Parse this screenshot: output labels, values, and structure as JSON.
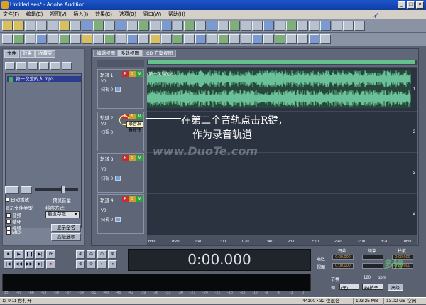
{
  "window": {
    "title": "Untitled.ses* - Adobe Audition",
    "btn_min": "_",
    "btn_max": "□",
    "btn_close": "×"
  },
  "menu": [
    "文件(F)",
    "编辑(E)",
    "视图(V)",
    "插入(I)",
    "效果(C)",
    "选项(O)",
    "窗口(W)",
    "帮助(H)"
  ],
  "left_panel": {
    "tabs": [
      "文件",
      "效果",
      "收藏夹"
    ],
    "file_item": "第一次爱的人.mp3",
    "auto_play": "自动播放",
    "preview_label": "预览音量",
    "show_type_label": "显示文件类型",
    "sort_label": "排序方式:",
    "sort_value": "最近存取",
    "types": [
      "音频",
      "循环",
      "视频",
      "MIDI"
    ],
    "full_name_btn": "显示全名",
    "advanced_btn": "高级选项"
  },
  "main": {
    "tabs": [
      "编辑视图",
      "多轨视图",
      "CD 方案视图"
    ],
    "tracks": [
      {
        "name": "轨道 1",
        "m": "M",
        "r": "R",
        "s": "S",
        "v_label": "V0",
        "out_label": "扫视 0",
        "in_label": "R",
        "number": "1"
      },
      {
        "name": "轨道 2",
        "m": "M",
        "r": "R",
        "s": "S",
        "v_label": "V0",
        "out_label": "扫视 0",
        "in_label": "R",
        "number": "2"
      },
      {
        "name": "轨道 3",
        "m": "M",
        "r": "R",
        "s": "S",
        "v_label": "V0",
        "out_label": "扫视 0",
        "in_label": "R",
        "number": "3"
      },
      {
        "name": "轨道 4",
        "m": "M",
        "r": "R",
        "s": "S",
        "v_label": "V0",
        "out_label": "扫视 0",
        "in_label": "R",
        "number": "4"
      }
    ],
    "clip_label": "第一次爱的人",
    "tooltip": "录音准备按钮",
    "callout_line1": "在第二个音轨点击R键，",
    "callout_line2": "作为录音轨道",
    "watermark": "www.DuoTe.com",
    "ruler": [
      "hms",
      "0:20",
      "0:40",
      "1:00",
      "1:20",
      "1:40",
      "2:00",
      "2:20",
      "2:40",
      "3:00",
      "3:20",
      "hms"
    ]
  },
  "transport": {
    "time": "0:00.000"
  },
  "selection": {
    "start_label": "开始",
    "end_label": "结束",
    "length_label": "长度",
    "sel_label": "选区",
    "view_label": "视图",
    "sel_start": "0:00.000",
    "sel_end": "",
    "sel_len": "0:00.000",
    "view_start": "0:00.000",
    "view_end": "",
    "view_len": "3:39.000",
    "tempo_label": "节奏",
    "key_label": "调",
    "tempo_val": "120",
    "bpm": "bpm",
    "key_val": "(无)",
    "beats": "4/4拍子",
    "adv": "高级"
  },
  "level_scale": [
    "dB",
    "-69",
    "-66",
    "-63",
    "-60",
    "-57",
    "-54",
    "-51",
    "-48",
    "-45",
    "-42",
    "-39",
    "-36",
    "-33",
    "-30",
    "-27",
    "-24",
    "-21",
    "-18",
    "-15",
    "-12",
    "-9",
    "-6",
    "-3",
    "0"
  ],
  "status": {
    "left": "以 9.11 秒打开",
    "rate": "44100 • 32 位混合",
    "mem": "103.25 MB",
    "free": "13.02 GB 空闲"
  },
  "watermark2": "多特"
}
